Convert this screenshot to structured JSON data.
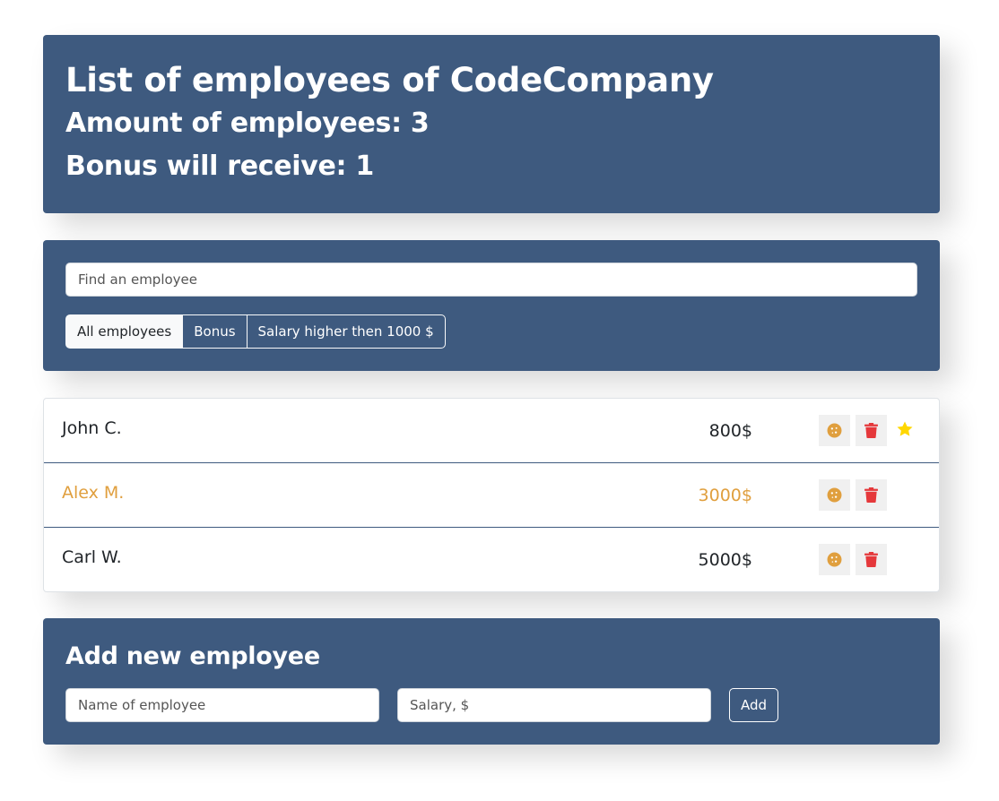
{
  "header": {
    "title": "List of employees of CodeCompany",
    "amount_label": "Amount of employees: 3",
    "bonus_label": "Bonus will receive: 1"
  },
  "search": {
    "placeholder": "Find an employee",
    "value": ""
  },
  "filters": [
    {
      "label": "All employees",
      "active": true
    },
    {
      "label": "Bonus",
      "active": false
    },
    {
      "label": "Salary higher then 1000 $",
      "active": false
    }
  ],
  "employees": [
    {
      "name": "John C.",
      "salary": "800$",
      "increase": false,
      "star": true
    },
    {
      "name": "Alex M.",
      "salary": "3000$",
      "increase": true,
      "star": false
    },
    {
      "name": "Carl W.",
      "salary": "5000$",
      "increase": false,
      "star": false
    }
  ],
  "add_form": {
    "title": "Add new employee",
    "name_placeholder": "Name of employee",
    "salary_placeholder": "Salary, $",
    "add_label": "Add"
  },
  "colors": {
    "panel": "#3e5a7f",
    "cookie": "#e09f3e",
    "trash": "#e5383b",
    "star": "#ffd700",
    "increase_text": "#e09f3e"
  },
  "icons": {
    "cookie": "cookie-icon",
    "trash": "trash-icon",
    "star": "star-icon"
  }
}
